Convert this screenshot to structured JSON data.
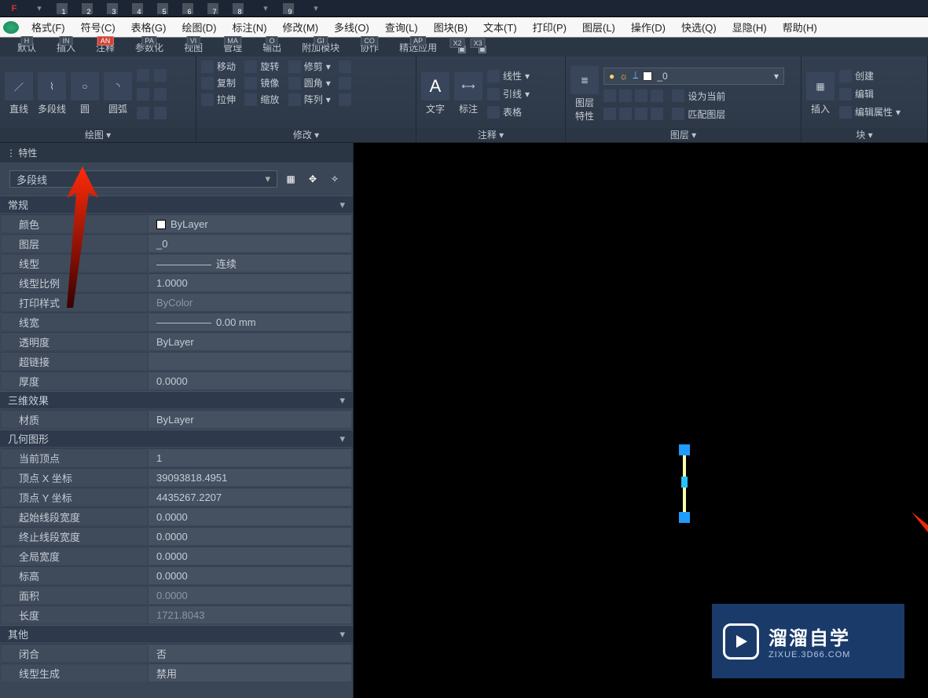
{
  "titlebar": {
    "app": "F",
    "tabs": [
      "1",
      "2",
      "3",
      "4",
      "5",
      "6",
      "7",
      "8",
      "9"
    ]
  },
  "menubar": [
    "格式(F)",
    "符号(C)",
    "表格(G)",
    "绘图(D)",
    "标注(N)",
    "修改(M)",
    "多线(O)",
    "查询(L)",
    "图块(B)",
    "文本(T)",
    "打印(P)",
    "图层(L)",
    "操作(D)",
    "快选(Q)",
    "显隐(H)",
    "帮助(H)"
  ],
  "tabs": [
    {
      "label": "默认",
      "badge": "H"
    },
    {
      "label": "插入",
      "badge": "IN"
    },
    {
      "label": "注释",
      "badge": "AN",
      "active": true
    },
    {
      "label": "参数化",
      "badge": "PA"
    },
    {
      "label": "视图",
      "badge": "VI"
    },
    {
      "label": "管理",
      "badge": "MA"
    },
    {
      "label": "输出",
      "badge": "O"
    },
    {
      "label": "附加模块",
      "badge": "GI"
    },
    {
      "label": "协作",
      "badge": "CO"
    },
    {
      "label": "精选应用",
      "badge": "AP"
    },
    {
      "label": "",
      "badge": "X2"
    },
    {
      "label": "",
      "badge": "X3"
    }
  ],
  "ribbon": {
    "draw": {
      "title": "绘图",
      "items": [
        "直线",
        "多段线",
        "圆",
        "圆弧"
      ]
    },
    "modify": {
      "title": "修改",
      "rows": [
        [
          "移动",
          "旋转",
          "修剪"
        ],
        [
          "复制",
          "镜像",
          "圆角"
        ],
        [
          "拉伸",
          "缩放",
          "阵列"
        ]
      ]
    },
    "annot": {
      "title": "注释",
      "items": [
        "文字",
        "标注"
      ],
      "rows": [
        "线性",
        "引线",
        "表格"
      ]
    },
    "layer": {
      "title": "图层",
      "main": "图层\n特性",
      "btns": [
        "设为当前",
        "匹配图层"
      ],
      "combo": "_0"
    },
    "insert": {
      "title": "插入",
      "main": "插入"
    },
    "block": {
      "title": "块",
      "rows": [
        "创建",
        "编辑",
        "编辑属性"
      ]
    }
  },
  "props": {
    "title": "特性",
    "filter": "多段线",
    "sections": {
      "general": {
        "title": "常规",
        "rows": [
          {
            "k": "颜色",
            "v": "ByLayer",
            "swatch": true
          },
          {
            "k": "图层",
            "v": "_0"
          },
          {
            "k": "线型",
            "v": "连续",
            "line": true
          },
          {
            "k": "线型比例",
            "v": "1.0000"
          },
          {
            "k": "打印样式",
            "v": "ByColor"
          },
          {
            "k": "线宽",
            "v": "0.00 mm",
            "line": true
          },
          {
            "k": "透明度",
            "v": "ByLayer"
          },
          {
            "k": "超链接",
            "v": ""
          },
          {
            "k": "厚度",
            "v": "0.0000"
          }
        ]
      },
      "threeD": {
        "title": "三维效果",
        "rows": [
          {
            "k": "材质",
            "v": "ByLayer"
          }
        ]
      },
      "geom": {
        "title": "几何图形",
        "rows": [
          {
            "k": "当前顶点",
            "v": "1"
          },
          {
            "k": "顶点 X 坐标",
            "v": "39093818.4951"
          },
          {
            "k": "顶点 Y 坐标",
            "v": "4435267.2207"
          },
          {
            "k": "起始线段宽度",
            "v": "0.0000"
          },
          {
            "k": "终止线段宽度",
            "v": "0.0000"
          },
          {
            "k": "全局宽度",
            "v": "0.0000"
          },
          {
            "k": "标高",
            "v": "0.0000"
          },
          {
            "k": "面积",
            "v": "0.0000"
          },
          {
            "k": "长度",
            "v": "1721.8043"
          }
        ]
      },
      "other": {
        "title": "其他",
        "rows": [
          {
            "k": "闭合",
            "v": "否"
          },
          {
            "k": "线型生成",
            "v": "禁用"
          }
        ]
      }
    }
  },
  "watermark": {
    "t1": "溜溜自学",
    "t2": "ZIXUE.3D66.COM"
  }
}
